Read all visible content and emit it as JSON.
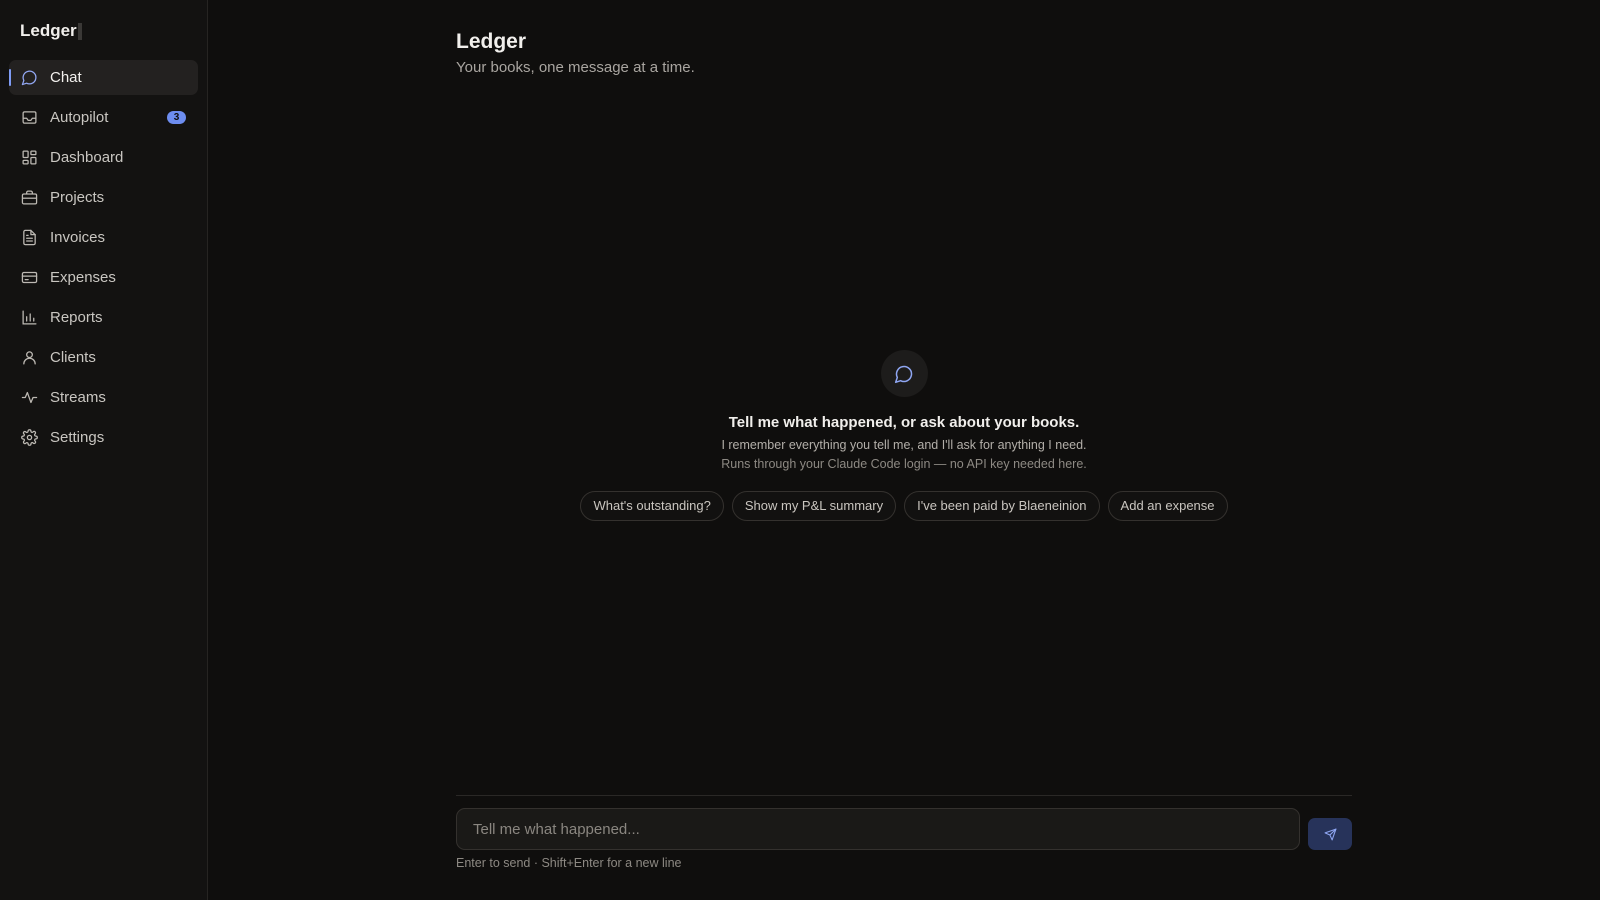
{
  "app": {
    "brand": "Ledger"
  },
  "sidebar": {
    "items": [
      {
        "label": "Chat",
        "icon": "chat-bubble-icon",
        "active": true
      },
      {
        "label": "Autopilot",
        "icon": "inbox-icon",
        "badge": "3"
      },
      {
        "label": "Dashboard",
        "icon": "grid-icon"
      },
      {
        "label": "Projects",
        "icon": "briefcase-icon"
      },
      {
        "label": "Invoices",
        "icon": "document-icon"
      },
      {
        "label": "Expenses",
        "icon": "credit-card-icon"
      },
      {
        "label": "Reports",
        "icon": "bar-chart-icon"
      },
      {
        "label": "Clients",
        "icon": "user-icon"
      },
      {
        "label": "Streams",
        "icon": "activity-icon"
      },
      {
        "label": "Settings",
        "icon": "gear-icon"
      }
    ]
  },
  "header": {
    "title": "Ledger",
    "subtitle": "Your books, one message at a time."
  },
  "empty_state": {
    "icon": "chat-bubble-icon",
    "title": "Tell me what happened, or ask about your books.",
    "line1": "I remember everything you tell me, and I'll ask for anything I need.",
    "line2": "Runs through your Claude Code login — no API key needed here.",
    "suggestions": [
      "What's outstanding?",
      "Show my P&L summary",
      "I've been paid by Blaeneinion",
      "Add an expense"
    ]
  },
  "composer": {
    "placeholder": "Tell me what happened...",
    "send_icon": "send-icon",
    "hint": "Enter to send · Shift+Enter for a new line"
  },
  "colors": {
    "background": "#0f0e0d",
    "sidebar": "#131211",
    "accent": "#7f9cf5",
    "badge": "#6d8df0",
    "send_button": "#27335a"
  }
}
